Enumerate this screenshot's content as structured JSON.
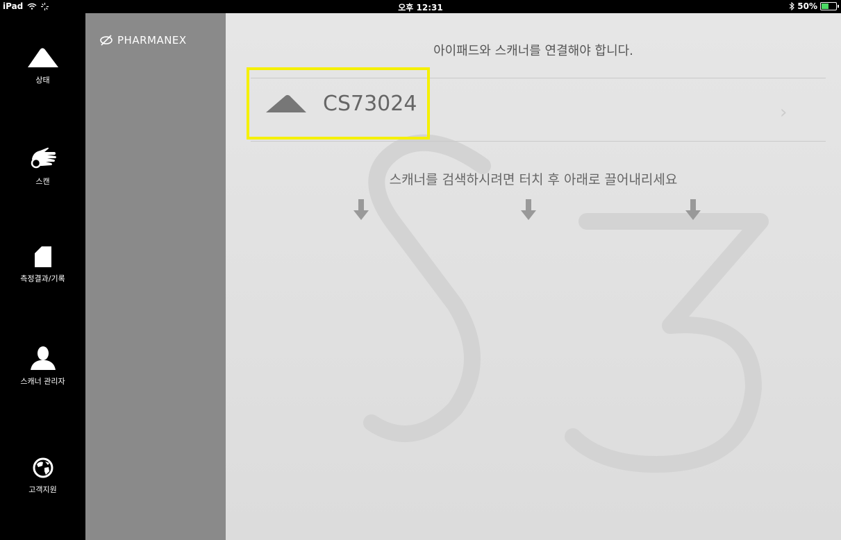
{
  "status_bar": {
    "device": "iPad",
    "time": "오후 12:31",
    "battery_text": "50%",
    "battery_level": 0.5,
    "icons": [
      "wifi-icon",
      "loading-icon",
      "bluetooth-icon",
      "battery-icon"
    ]
  },
  "nav": {
    "items": [
      {
        "label": "상태",
        "icon": "scanner-icon"
      },
      {
        "label": "스캔",
        "icon": "hand-icon"
      },
      {
        "label": "측정결과/기록",
        "icon": "document-icon"
      },
      {
        "label": "스캐너 관리자",
        "icon": "user-icon"
      },
      {
        "label": "고객지원",
        "icon": "globe-icon"
      }
    ]
  },
  "brand": {
    "name": "PHARMANEX"
  },
  "main": {
    "title": "아이패드와 스캐너를 연결해야 합니다.",
    "scanner": {
      "name": "CS73024"
    },
    "hint": "스캐너를 검색하시려면 터치 후 아래로 끌어내리세요"
  },
  "colors": {
    "highlight": "#f5f000",
    "sidebar": "#000000",
    "panel": "#8a8a8a",
    "main_bg": "#e2e2e2"
  }
}
